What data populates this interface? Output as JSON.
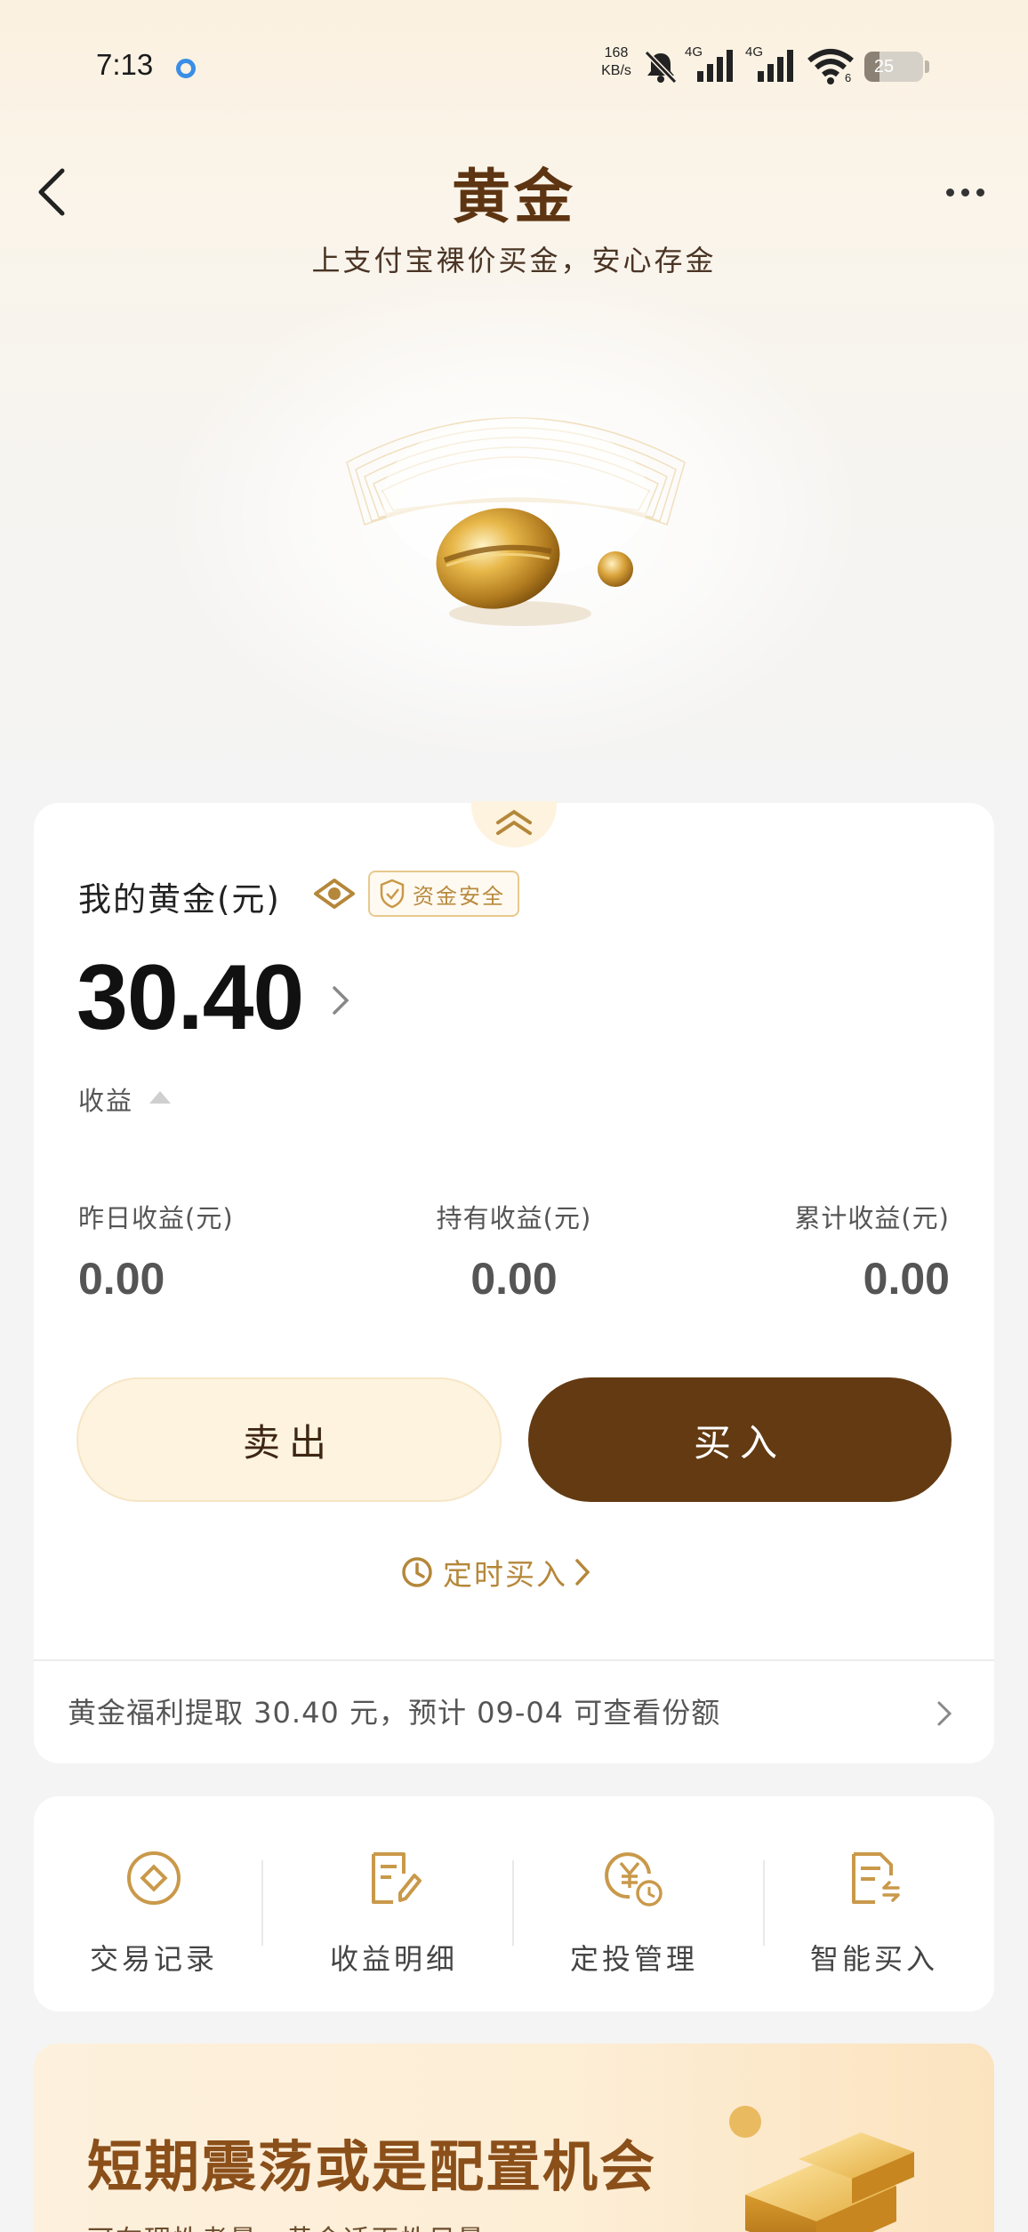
{
  "status_bar": {
    "time": "7:13",
    "net_speed_value": "168",
    "net_speed_unit": "KB/s",
    "sim1_label": "4G",
    "sim2_label": "4G",
    "wifi_label": "6",
    "battery_level": "25",
    "battery_fraction": 0.25
  },
  "header": {
    "title": "黄金",
    "subtitle": "上支付宝裸价买金，安心存金"
  },
  "assets": {
    "label": "我的黄金(元)",
    "safe_badge": "资金安全",
    "amount": "30.40",
    "income_toggle": "收益",
    "stats": [
      {
        "label": "昨日收益(元)",
        "value": "0.00"
      },
      {
        "label": "持有收益(元)",
        "value": "0.00"
      },
      {
        "label": "累计收益(元)",
        "value": "0.00"
      }
    ],
    "sell_label": "卖出",
    "buy_label": "买入",
    "scheduled_buy_label": "定时买入",
    "welfare_notice": "黄金福利提取 30.40 元，预计 09-04 可查看份额"
  },
  "shortcuts": [
    {
      "label": "交易记录",
      "icon": "transaction-record-icon"
    },
    {
      "label": "收益明细",
      "icon": "income-detail-icon"
    },
    {
      "label": "定投管理",
      "icon": "auto-invest-icon"
    },
    {
      "label": "智能买入",
      "icon": "smart-buy-icon"
    }
  ],
  "promo": {
    "title": "短期震荡或是配置机会",
    "subtitle": "可在理性考量，黄金适面性目量"
  },
  "colors": {
    "brand_brown": "#633a12",
    "gold_accent": "#b5873a",
    "title_brown": "#5e3512",
    "sell_bg": "#fdf3df"
  }
}
